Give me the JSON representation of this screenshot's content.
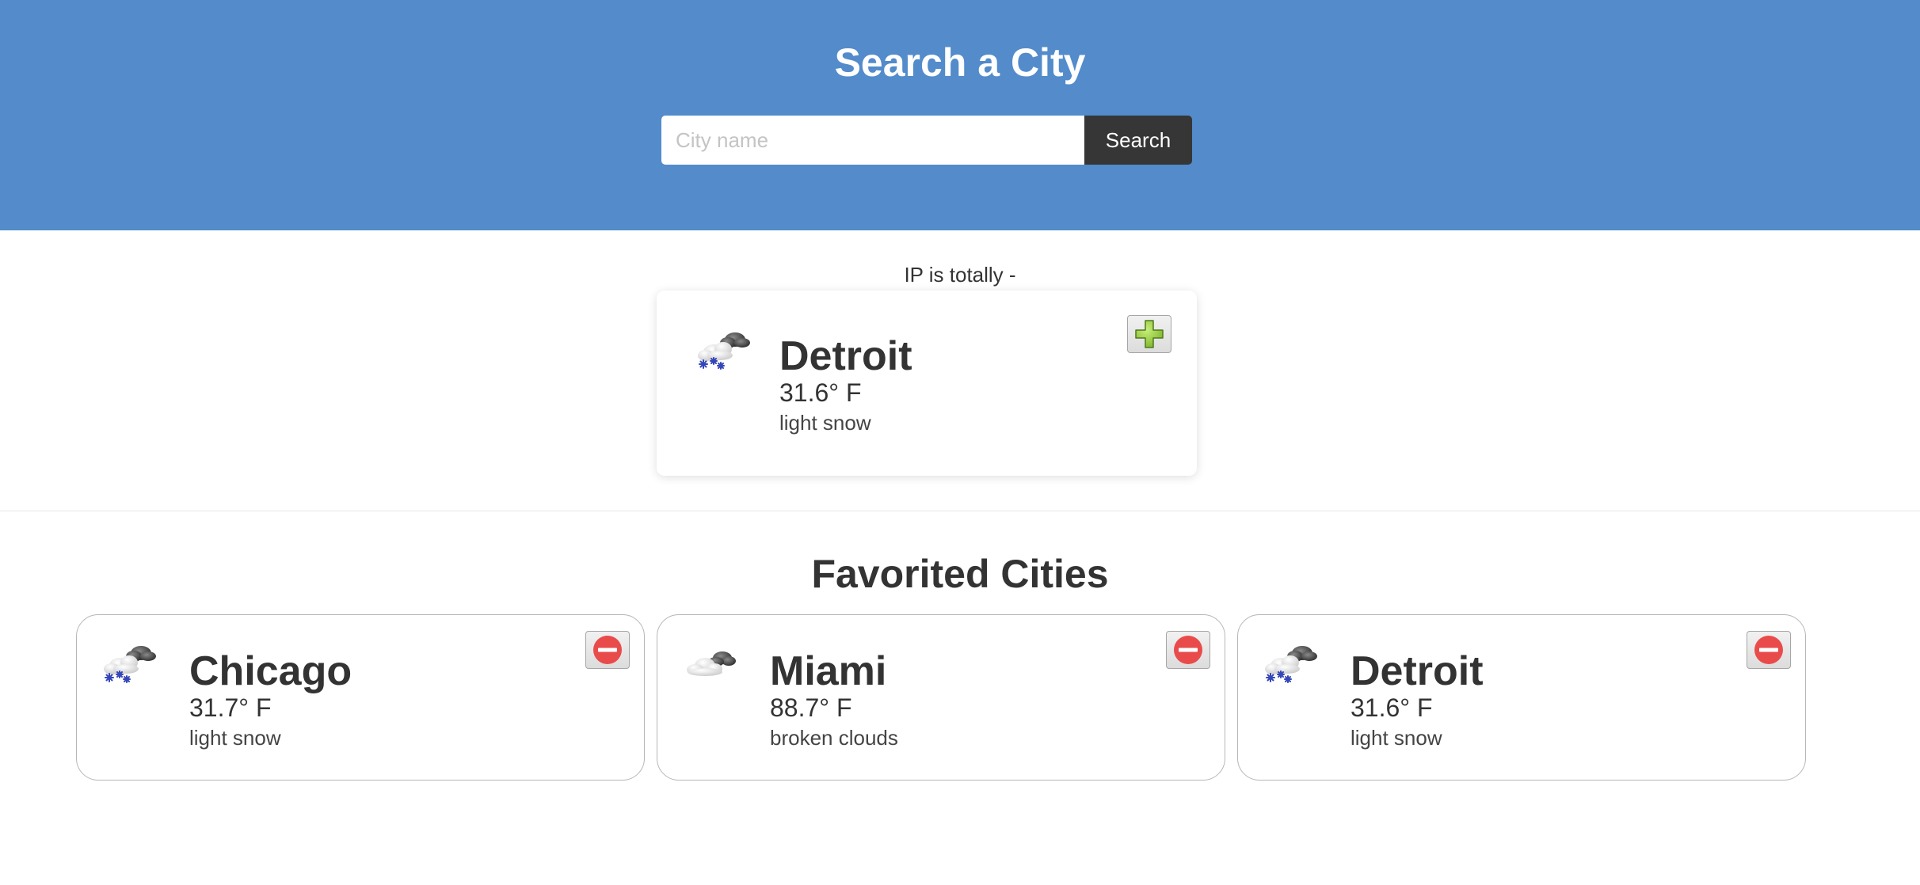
{
  "header": {
    "title": "Search a City",
    "search_placeholder": "City name",
    "search_value": "",
    "search_button_label": "Search"
  },
  "current": {
    "ip_text": "IP is totally -",
    "city": "Detroit",
    "temp": "31.6° F",
    "description": "light snow",
    "icon": "snow-cloud-icon",
    "action_icon": "plus-icon"
  },
  "favorites": {
    "title": "Favorited Cities",
    "items": [
      {
        "city": "Chicago",
        "temp": "31.7° F",
        "description": "light snow",
        "icon": "snow-cloud-icon",
        "action_icon": "minus-icon"
      },
      {
        "city": "Miami",
        "temp": "88.7° F",
        "description": "broken clouds",
        "icon": "broken-clouds-icon",
        "action_icon": "minus-icon"
      },
      {
        "city": "Detroit",
        "temp": "31.6° F",
        "description": "light snow",
        "icon": "snow-cloud-icon",
        "action_icon": "minus-icon"
      }
    ]
  },
  "colors": {
    "header_bg": "#538bcb",
    "button_dark": "#363636",
    "add_green": "#8dc63f",
    "remove_red": "#e94b4b"
  }
}
